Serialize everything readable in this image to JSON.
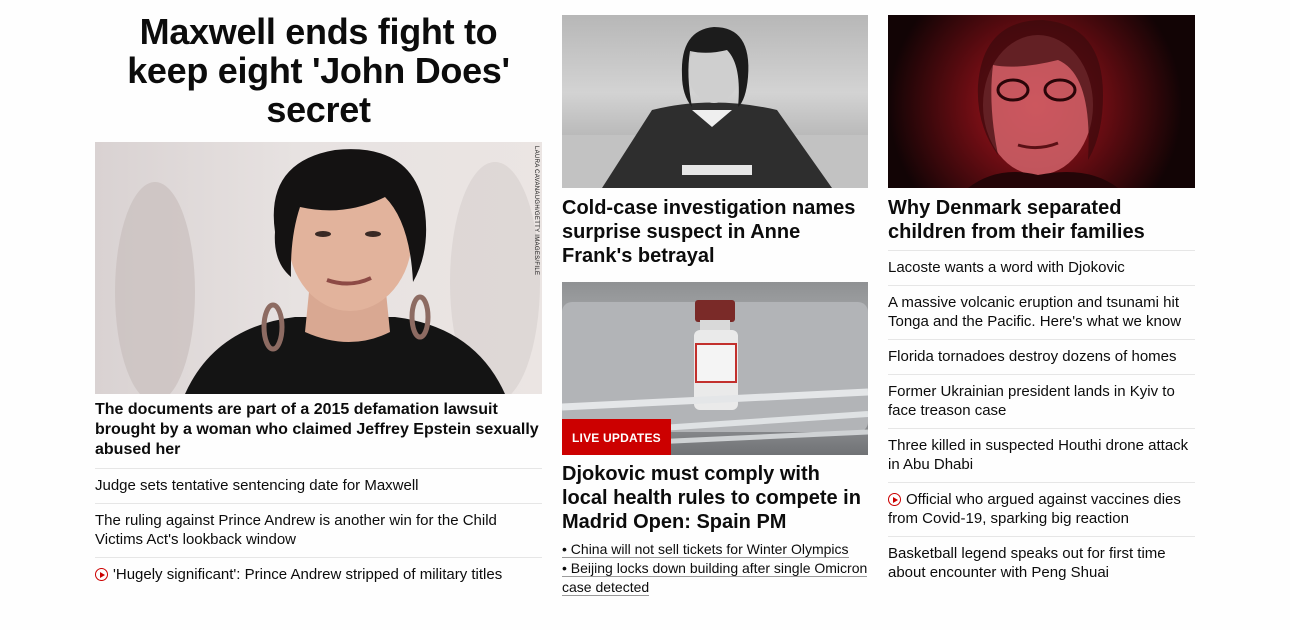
{
  "lead": {
    "headline": "Maxwell ends fight to keep eight 'John Does' secret",
    "image_credit": "LAURA CAVANAUGH/GETTY IMAGES/FILE",
    "description": "The documents are part of a 2015 defamation lawsuit brought by a woman who claimed Jeffrey Epstein sexually abused her",
    "related": [
      {
        "text": "Judge sets tentative sentencing date for Maxwell",
        "video": false
      },
      {
        "text": "The ruling against Prince Andrew is another win for the Child Victims Act's lookback window",
        "video": false
      },
      {
        "text": "'Hugely significant': Prince Andrew stripped of military titles",
        "video": true
      }
    ]
  },
  "middle": {
    "anne_headline": "Cold-case investigation names surprise suspect in Anne Frank's betrayal",
    "live_badge": "LIVE UPDATES",
    "djokovic_headline": "Djokovic must comply with local health rules to compete in Madrid Open: Spain PM",
    "bullets": [
      "• China will not sell tickets for Winter Olympics",
      "• Beijing locks down building after single Omicron case detected"
    ]
  },
  "right": {
    "denmark_headline": "Why Denmark separated children from their families",
    "stories": [
      {
        "text": "Lacoste wants a word with Djokovic",
        "video": false
      },
      {
        "text": "A massive volcanic eruption and tsunami hit Tonga and the Pacific. Here's what we know",
        "video": false
      },
      {
        "text": "Florida tornadoes destroy dozens of homes",
        "video": false
      },
      {
        "text": "Former Ukrainian president lands in Kyiv to face treason case",
        "video": false
      },
      {
        "text": "Three killed in suspected Houthi drone attack in Abu Dhabi",
        "video": false
      },
      {
        "text": "Official who argued against vaccines dies from Covid-19, sparking big reaction",
        "video": true
      },
      {
        "text": "Basketball legend speaks out for first time about encounter with Peng Shuai",
        "video": false
      }
    ]
  },
  "colors": {
    "accent": "#cc0000",
    "text": "#0c0c0c",
    "divider": "#e6e6e6"
  }
}
